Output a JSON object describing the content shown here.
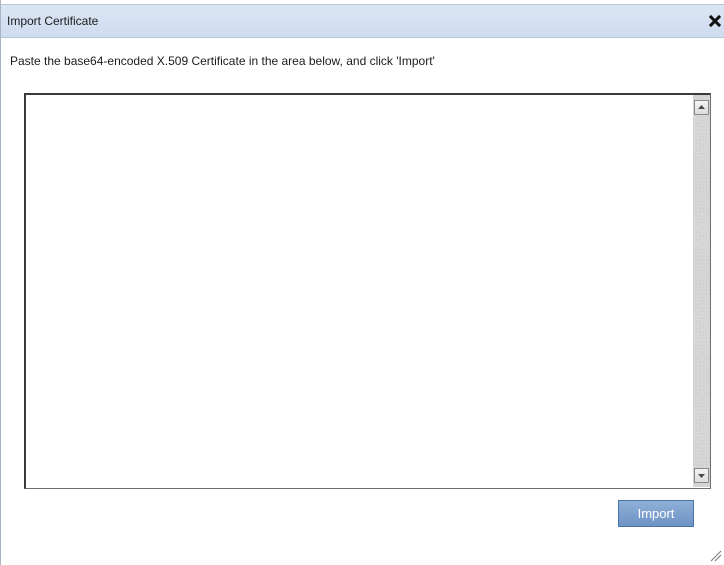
{
  "dialog": {
    "title": "Import Certificate",
    "close_icon": "close-icon"
  },
  "instructions": "Paste the base64-encoded X.509 Certificate in the area below, and click 'Import'",
  "certificate_field": {
    "value": "",
    "placeholder": ""
  },
  "buttons": {
    "import_label": "Import"
  },
  "icons": {
    "scroll_up": "arrow-up-icon",
    "scroll_down": "arrow-down-icon",
    "resize": "resize-grip-icon"
  },
  "colors": {
    "titlebar": "#cfdcef",
    "import_button": "#7aa0cf",
    "border": "#3a3a3a"
  }
}
